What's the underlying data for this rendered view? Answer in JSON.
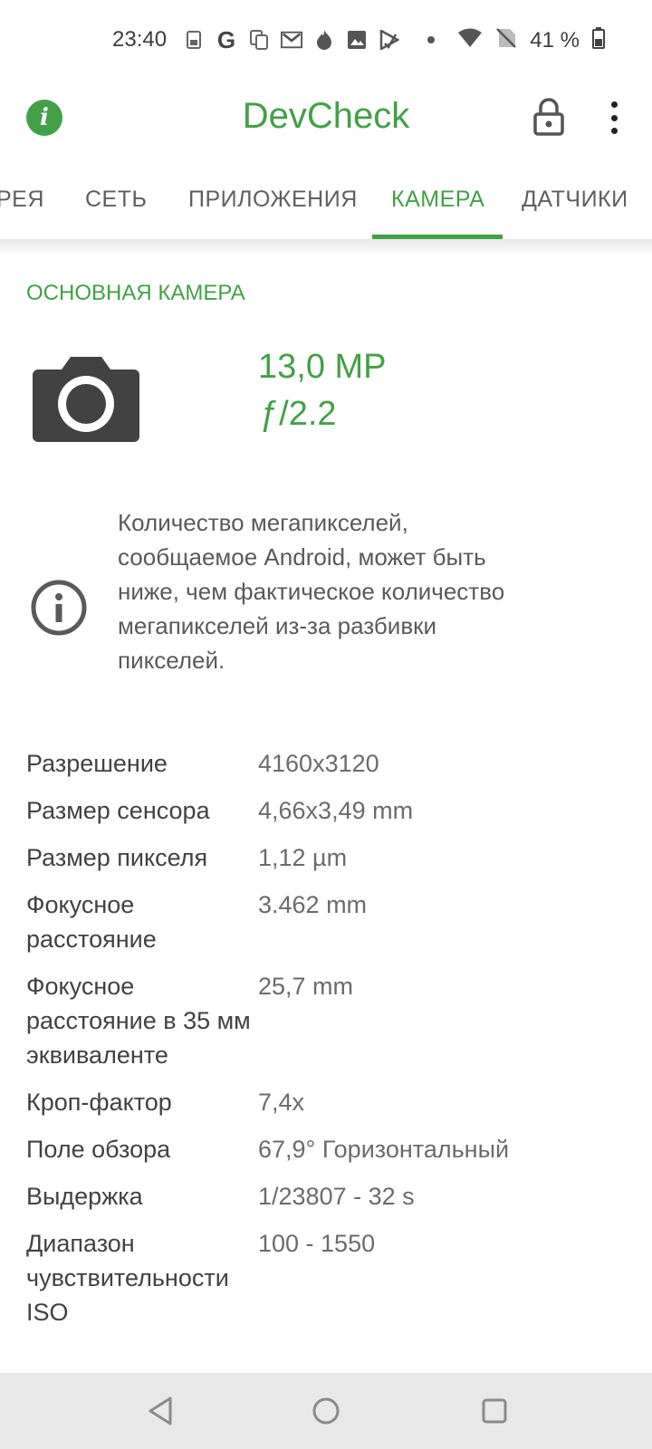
{
  "status_bar": {
    "time": "23:40",
    "notification_icons": [
      "sim-icon",
      "google-icon",
      "copy-icon",
      "gmail-icon",
      "fire-icon",
      "image-icon",
      "play-store-icon",
      "dot-icon"
    ],
    "battery_text": "41 %"
  },
  "app_bar": {
    "title": "DevCheck"
  },
  "tabs": [
    {
      "label": "РЕЯ"
    },
    {
      "label": "СЕТЬ"
    },
    {
      "label": "ПРИЛОЖЕНИЯ"
    },
    {
      "label": "КАМЕРА"
    },
    {
      "label": "ДАТЧИКИ"
    }
  ],
  "active_tab": "КАМЕРА",
  "section": {
    "title": "ОСНОВНАЯ КАМЕРА",
    "megapixels": "13,0 MP",
    "aperture": "ƒ/2.2",
    "note": "Количество мегапикселей, сообщаемое Android, может быть ниже, чем фактическое количество мегапикселей из-за разбивки пикселей."
  },
  "specs": [
    {
      "key": "Разрешение",
      "value": "4160x3120"
    },
    {
      "key": "Размер сенсора",
      "value": "4,66x3,49 mm"
    },
    {
      "key": "Размер пикселя",
      "value": "1,12 µm"
    },
    {
      "key": "Фокусное расстояние",
      "value": "3.462 mm"
    },
    {
      "key": "Фокусное расстояние в 35 мм эквиваленте",
      "value": "25,7 mm"
    },
    {
      "key": "Кроп-фактор",
      "value": "7,4x"
    },
    {
      "key": "Поле обзора",
      "value": "67,9° Горизонтальный"
    },
    {
      "key": "Выдержка",
      "value": "1/23807 - 32 s"
    },
    {
      "key": "Диапазон чувствительности ISO",
      "value": "100 - 1550"
    }
  ],
  "colors": {
    "accent": "#43a047",
    "nav_bar": "#e8e8e8"
  }
}
